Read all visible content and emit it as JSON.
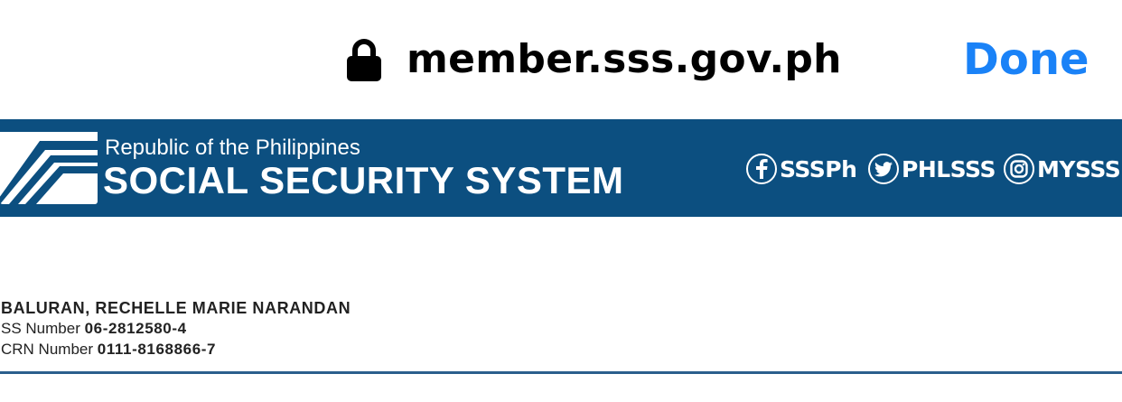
{
  "browser": {
    "url": "member.sss.gov.ph",
    "done_label": "Done",
    "accent": "#1a82f7",
    "lock_icon": "lock-icon"
  },
  "banner": {
    "background": "#0c4f80",
    "logo": "sss-logo",
    "republic_text": "Republic of the Philippines",
    "title": "SOCIAL SECURITY SYSTEM",
    "social": [
      {
        "icon": "facebook-icon",
        "label": "SSSPh"
      },
      {
        "icon": "twitter-icon",
        "label": "PHLSSS"
      },
      {
        "icon": "instagram-icon",
        "label": "MYSSSI"
      }
    ]
  },
  "member": {
    "name": "BALURAN, RECHELLE MARIE NARANDAN",
    "ss_label": "SS Number",
    "ss_value": "06-2812580-4",
    "crn_label": "CRN Number",
    "crn_value": "0111-8168866-7",
    "divider_color": "#2b5f8d"
  }
}
